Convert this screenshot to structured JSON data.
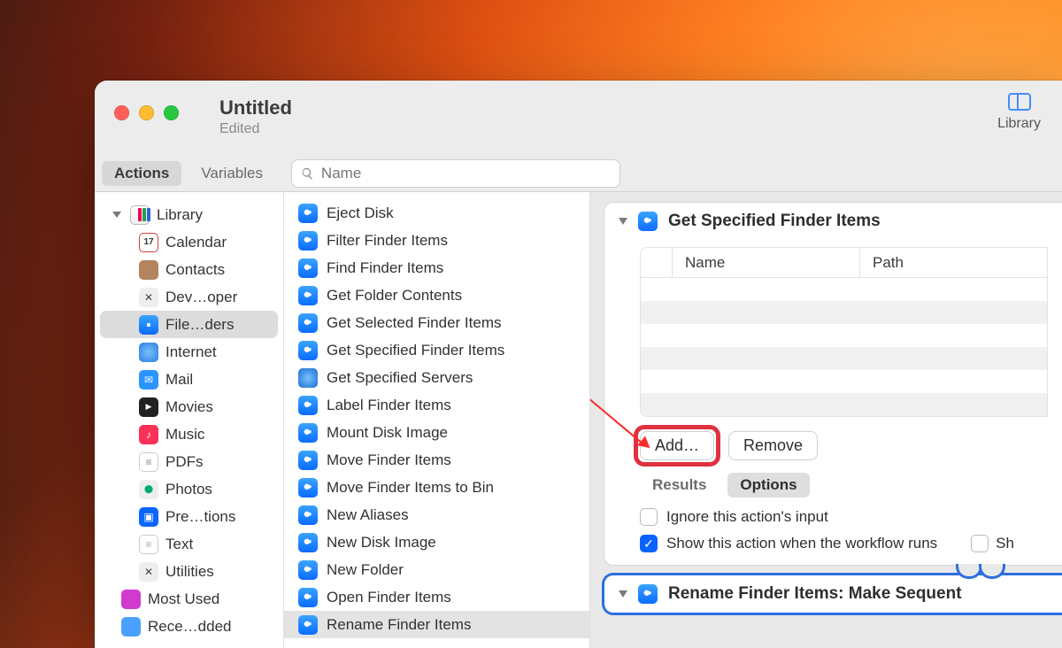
{
  "window": {
    "title": "Untitled",
    "subtitle": "Edited"
  },
  "toolbarRight": {
    "label": "Library"
  },
  "segments": {
    "actions": "Actions",
    "variables": "Variables"
  },
  "search": {
    "placeholder": "Name"
  },
  "sidebar": {
    "root": "Library",
    "items": [
      {
        "label": "Calendar",
        "icon": "cal"
      },
      {
        "label": "Contacts",
        "icon": "con"
      },
      {
        "label": "Dev…oper",
        "icon": "dev"
      },
      {
        "label": "File…ders",
        "icon": "fin",
        "selected": true
      },
      {
        "label": "Internet",
        "icon": "net"
      },
      {
        "label": "Mail",
        "icon": "mail"
      },
      {
        "label": "Movies",
        "icon": "mov"
      },
      {
        "label": "Music",
        "icon": "mus"
      },
      {
        "label": "PDFs",
        "icon": "pdf"
      },
      {
        "label": "Photos",
        "icon": "pho"
      },
      {
        "label": "Pre…tions",
        "icon": "pre"
      },
      {
        "label": "Text",
        "icon": "txt"
      },
      {
        "label": "Utilities",
        "icon": "dev"
      }
    ],
    "extra": [
      {
        "label": "Most Used",
        "icon": "fp"
      },
      {
        "label": "Rece…dded",
        "icon": "fb"
      }
    ]
  },
  "actions": [
    "Eject Disk",
    "Filter Finder Items",
    "Find Finder Items",
    "Get Folder Contents",
    "Get Selected Finder Items",
    "Get Specified Finder Items",
    "Get Specified Servers",
    "Label Finder Items",
    "Mount Disk Image",
    "Move Finder Items",
    "Move Finder Items to Bin",
    "New Aliases",
    "New Disk Image",
    "New Folder",
    "Open Finder Items",
    "Rename Finder Items"
  ],
  "actionsNetIndex": 6,
  "actionsSelectedIndex": 15,
  "workflow": {
    "card1": {
      "title": "Get Specified Finder Items",
      "columns": {
        "name": "Name",
        "path": "Path"
      },
      "buttons": {
        "add": "Add…",
        "remove": "Remove"
      },
      "tabs": {
        "results": "Results",
        "options": "Options"
      },
      "options": {
        "ignore": "Ignore this action's input",
        "show": "Show this action when the workflow runs",
        "trailing": "Sh"
      }
    },
    "card2": {
      "title": "Rename Finder Items: Make Sequent"
    }
  }
}
